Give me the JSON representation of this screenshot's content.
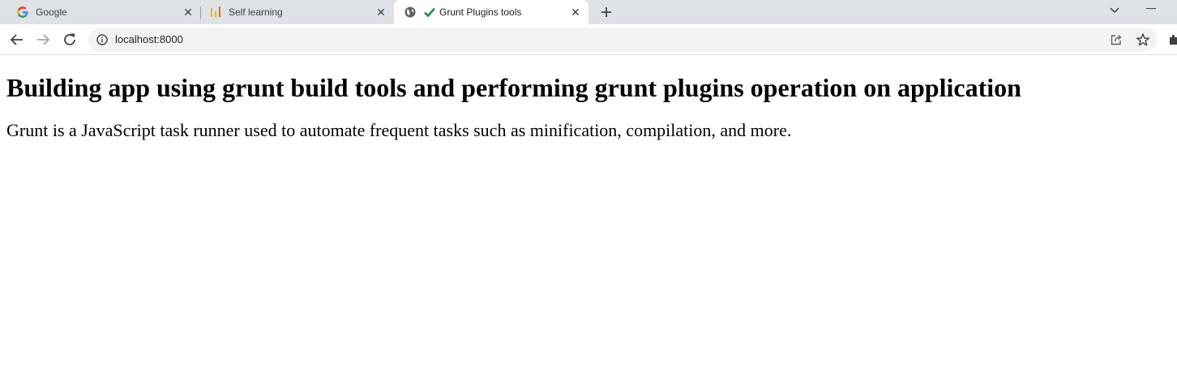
{
  "browser": {
    "tabs": [
      {
        "title": "Google",
        "favicon": "google-g-icon"
      },
      {
        "title": "Self learning",
        "favicon": "bar-chart-icon"
      },
      {
        "title": "Grunt Plugins tools",
        "favicon": "globe-icon",
        "active": true
      }
    ],
    "address": "localhost:8000"
  },
  "page": {
    "heading": "Building app using grunt build tools and performing grunt plugins operation on application",
    "paragraph": "Grunt is a JavaScript task runner used to automate frequent tasks such as minification, compilation, and more."
  },
  "colors": {
    "tabstrip": "#dee1e6",
    "omnibox": "#f1f3f4",
    "check": "#1e8e3e"
  }
}
